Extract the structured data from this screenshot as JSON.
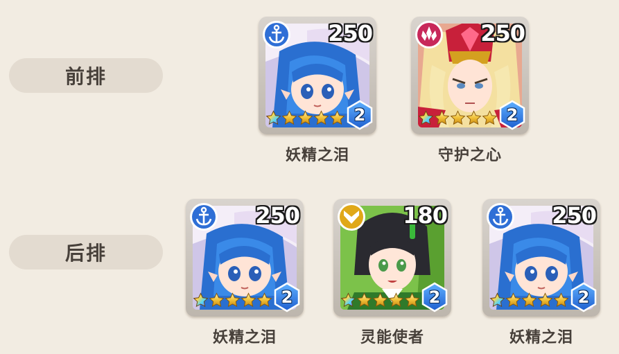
{
  "rows": [
    {
      "label": "前排",
      "heroes": [
        {
          "name": "妖精之泪",
          "level": "250",
          "rank": "2",
          "stars": 4,
          "type_icon": "anchor-icon",
          "type_color": "#2f6fd6",
          "portrait": "blue-hair-witch"
        },
        {
          "name": "守护之心",
          "level": "250",
          "rank": "2",
          "stars": 4,
          "type_icon": "crystal-icon",
          "type_color": "#c8285a",
          "portrait": "red-armored-knight"
        }
      ]
    },
    {
      "label": "后排",
      "heroes": [
        {
          "name": "妖精之泪",
          "level": "250",
          "rank": "2",
          "stars": 4,
          "type_icon": "anchor-icon",
          "type_color": "#2f6fd6",
          "portrait": "blue-hair-witch"
        },
        {
          "name": "灵能使者",
          "level": "180",
          "rank": "2",
          "stars": 4,
          "type_icon": "chevron-v-icon",
          "type_color": "#e0a818",
          "portrait": "green-uniform-girl"
        },
        {
          "name": "妖精之泪",
          "level": "250",
          "rank": "2",
          "stars": 4,
          "type_icon": "anchor-icon",
          "type_color": "#2f6fd6",
          "portrait": "blue-hair-witch"
        }
      ]
    }
  ]
}
